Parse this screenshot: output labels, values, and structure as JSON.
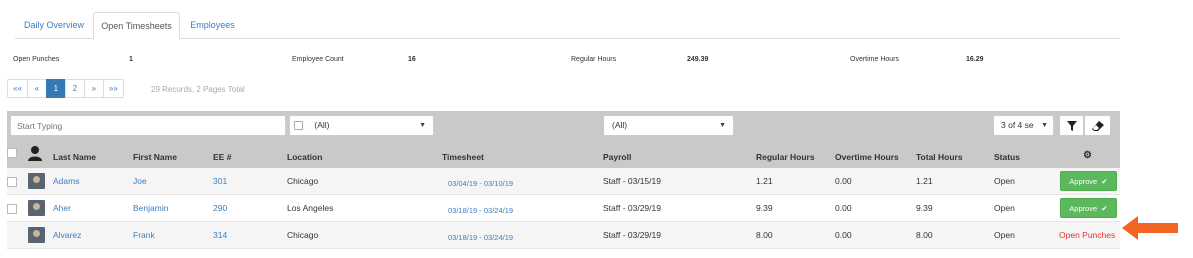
{
  "tabs": [
    {
      "label": "Daily Overview"
    },
    {
      "label": "Open Timesheets"
    },
    {
      "label": "Employees"
    }
  ],
  "stats": {
    "open_punches_label": "Open Punches",
    "open_punches_value": "1",
    "employee_count_label": "Employee Count",
    "employee_count_value": "16",
    "regular_hours_label": "Regular Hours",
    "regular_hours_value": "249.39",
    "overtime_hours_label": "Overtime Hours",
    "overtime_hours_value": "16.29"
  },
  "pagination": {
    "first": "««",
    "prev": "«",
    "pages": [
      "1",
      "2"
    ],
    "active_page": "1",
    "next": "»",
    "last": "»»",
    "records_text": "29 Records, 2 Pages Total"
  },
  "filters": {
    "search_placeholder": "Start Typing",
    "location_select": "(All)",
    "payroll_select": "(All)",
    "columns_select": "3 of 4 se",
    "filter_icon": "filter-icon",
    "eraser_icon": "eraser-icon"
  },
  "table": {
    "headers": {
      "last_name": "Last Name",
      "first_name": "First Name",
      "ee": "EE #",
      "location": "Location",
      "timesheet": "Timesheet",
      "payroll": "Payroll",
      "regular_hours": "Regular Hours",
      "overtime_hours": "Overtime Hours",
      "total_hours": "Total Hours",
      "status": "Status"
    },
    "rows": [
      {
        "last": "Adams",
        "first": "Joe",
        "ee": "301",
        "location": "Chicago",
        "timesheet": "03/04/19 - 03/10/19",
        "payroll": "Staff - 03/15/19",
        "regular": "1.21",
        "overtime": "0.00",
        "total": "1.21",
        "status": "Open",
        "action": "Approve"
      },
      {
        "last": "Aher",
        "first": "Benjamin",
        "ee": "290",
        "location": "Los Angeles",
        "timesheet": "03/18/19 - 03/24/19",
        "payroll": "Staff - 03/29/19",
        "regular": "9.39",
        "overtime": "0.00",
        "total": "9.39",
        "status": "Open",
        "action": "Approve"
      },
      {
        "last": "Alvarez",
        "first": "Frank",
        "ee": "314",
        "location": "Chicago",
        "timesheet": "03/18/19 - 03/24/19",
        "payroll": "Staff - 03/29/19",
        "regular": "8.00",
        "overtime": "0.00",
        "total": "8.00",
        "status": "Open",
        "action": "Open Punches"
      }
    ]
  },
  "colors": {
    "accent": "#337ab7",
    "approve": "#5cb85c",
    "warning": "#e8322a",
    "arrow": "#f26522"
  }
}
